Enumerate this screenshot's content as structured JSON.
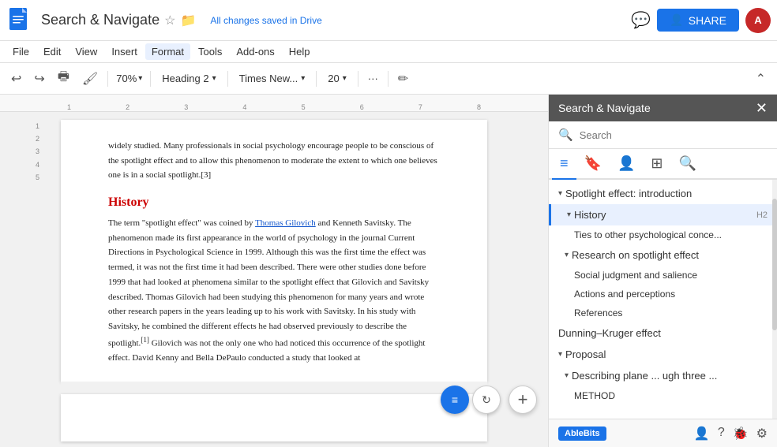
{
  "app": {
    "title": "Search & Navigate",
    "cloud_save": "All changes saved in Drive"
  },
  "menu": {
    "items": [
      "File",
      "Edit",
      "View",
      "Insert",
      "Format",
      "Tools",
      "Add-ons",
      "Help"
    ]
  },
  "toolbar": {
    "undo_label": "↩",
    "redo_label": "↪",
    "print_label": "🖶",
    "paint_label": "🖌",
    "zoom_value": "70%",
    "style_value": "Heading 2",
    "font_value": "Times New...",
    "size_value": "20",
    "more_label": "···",
    "pencil_label": "✏"
  },
  "share_button": "SHARE",
  "side_panel": {
    "title": "Search & Navigate",
    "search_placeholder": "Search",
    "tabs": [
      "≡",
      "🔖",
      "👤",
      "⊞",
      "🔍"
    ],
    "nav_items": [
      {
        "level": "h1",
        "label": "Spotlight effect: introduction",
        "collapsed": true
      },
      {
        "level": "h2",
        "label": "History",
        "badge": "H2",
        "active": true
      },
      {
        "level": "h3",
        "label": "Ties to other psychological conce..."
      },
      {
        "level": "h2",
        "label": "Research on spotlight effect",
        "collapsed": true
      },
      {
        "level": "h3",
        "label": "Social judgment and salience"
      },
      {
        "level": "h3",
        "label": "Actions and perceptions"
      },
      {
        "level": "h3",
        "label": "References"
      },
      {
        "level": "h1",
        "label": "Dunning–Kruger effect"
      },
      {
        "level": "h1",
        "label": "Proposal",
        "collapsed": true
      },
      {
        "level": "h2",
        "label": "Describing plane ... ugh three ..."
      },
      {
        "level": "h3",
        "label": "METHOD"
      }
    ]
  },
  "document": {
    "intro_text": "widely studied. Many professionals in social psychology encourage people to be conscious of the spotlight effect and to allow this phenomenon to moderate the extent to which one believes one is in a social spotlight.[3]",
    "heading": "History",
    "body_text": "The term \"spotlight effect\" was coined by Thomas Gilovich and Kenneth Savitsky. The phenomenon made its first appearance in the world of psychology in the journal Current Directions in Psychological Science in 1999. Although this was the first time the effect was termed, it was not the first time it had been described. There were other studies done before 1999 that had looked at phenomena similar to the spotlight effect that Gilovich and Savitsky described. Thomas Gilovich had been studying this phenomenon for many years and wrote other research papers in the years leading up to his work with Savitsky. In his study with Savitsky, he combined the different effects he had observed previously to describe the spotlight.[1] Gilovich was not the only one who had noticed this occurrence of the spotlight effect. David Kenny and Bella DePaulo conducted a study that looked at"
  },
  "ablebits": {
    "logo": "AbleBits",
    "icons": [
      "👤",
      "?",
      "🐞",
      "⚙"
    ]
  }
}
